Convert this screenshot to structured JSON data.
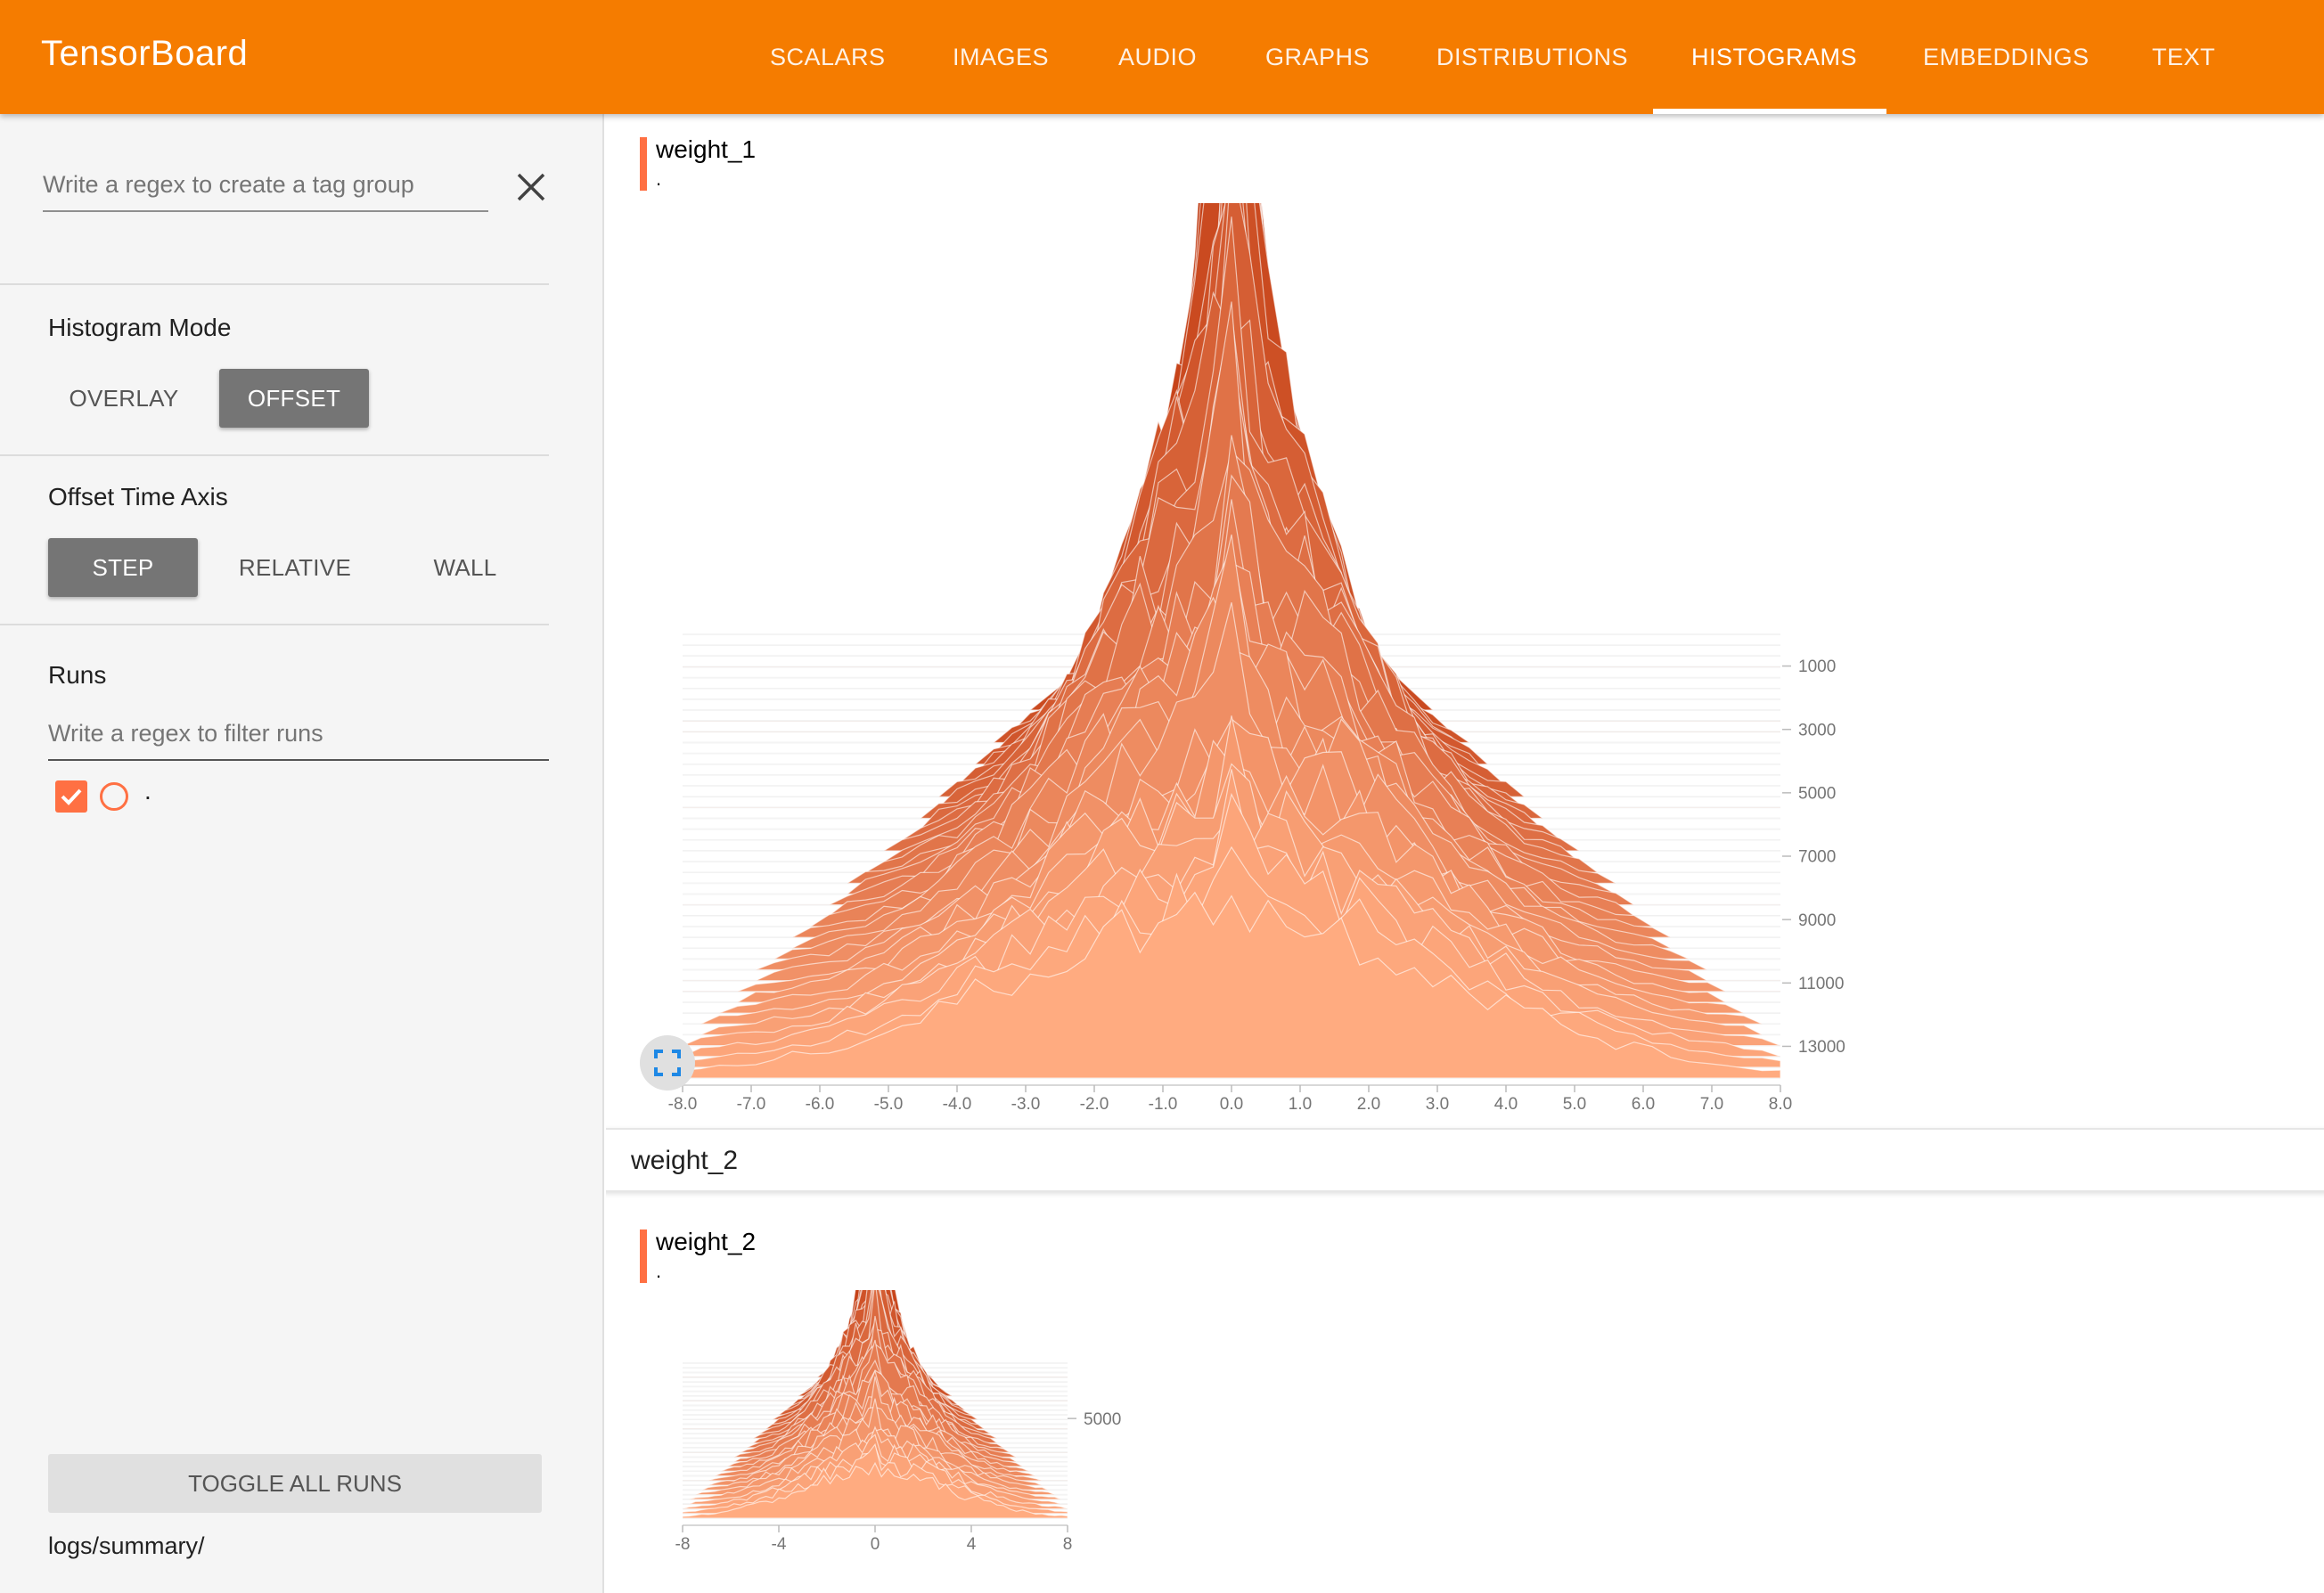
{
  "app": {
    "title": "TensorBoard"
  },
  "nav": {
    "tabs": [
      {
        "label": "SCALARS"
      },
      {
        "label": "IMAGES"
      },
      {
        "label": "AUDIO"
      },
      {
        "label": "GRAPHS"
      },
      {
        "label": "DISTRIBUTIONS"
      },
      {
        "label": "HISTOGRAMS",
        "active": true
      },
      {
        "label": "EMBEDDINGS"
      },
      {
        "label": "TEXT"
      }
    ]
  },
  "sidebar": {
    "tag_group_placeholder": "Write a regex to create a tag group",
    "histogram_mode": {
      "title": "Histogram Mode",
      "options": [
        "OVERLAY",
        "OFFSET"
      ],
      "selected": "OFFSET"
    },
    "time_axis": {
      "title": "Offset Time Axis",
      "options": [
        "STEP",
        "RELATIVE",
        "WALL"
      ],
      "selected": "STEP"
    },
    "runs": {
      "title": "Runs",
      "filter_placeholder": "Write a regex to filter runs",
      "items": [
        {
          "name": ".",
          "checked": true
        }
      ]
    },
    "toggle_all_label": "TOGGLE ALL RUNS",
    "logdir": "logs/summary/"
  },
  "main": {
    "group_title": "weight_2",
    "cards": [
      {
        "tag": "weight_1",
        "run": "."
      },
      {
        "tag": "weight_2",
        "run": "."
      }
    ]
  },
  "colors": {
    "accent": "#f57c00",
    "run": "#ff7043",
    "hist_dark": "#bf360c",
    "hist_light": "#ffab80"
  },
  "icons": {
    "close": "close-icon",
    "fullscreen": "fullscreen-icon",
    "check": "check-icon"
  },
  "chart_data": [
    {
      "type": "histogram",
      "mode": "offset",
      "tag": "weight_1",
      "x_ticks": [
        "-8.0",
        "-7.0",
        "-6.0",
        "-5.0",
        "-4.0",
        "-3.0",
        "-2.0",
        "-1.0",
        "0.0",
        "1.0",
        "2.0",
        "3.0",
        "4.0",
        "5.0",
        "6.0",
        "7.0",
        "8.0"
      ],
      "xlim": [
        -8,
        8
      ],
      "y_ticks": [
        "1000",
        "3000",
        "5000",
        "7000",
        "9000",
        "11000",
        "13000"
      ],
      "step_range": [
        0,
        14000
      ],
      "peak_x": 0
    },
    {
      "type": "histogram",
      "mode": "offset",
      "tag": "weight_2",
      "x_ticks": [
        "-8",
        "-4",
        "0",
        "4",
        "8"
      ],
      "xlim": [
        -8,
        8
      ],
      "y_ticks": [
        "5000"
      ],
      "step_range": [
        0,
        14000
      ],
      "peak_x": 0
    }
  ]
}
